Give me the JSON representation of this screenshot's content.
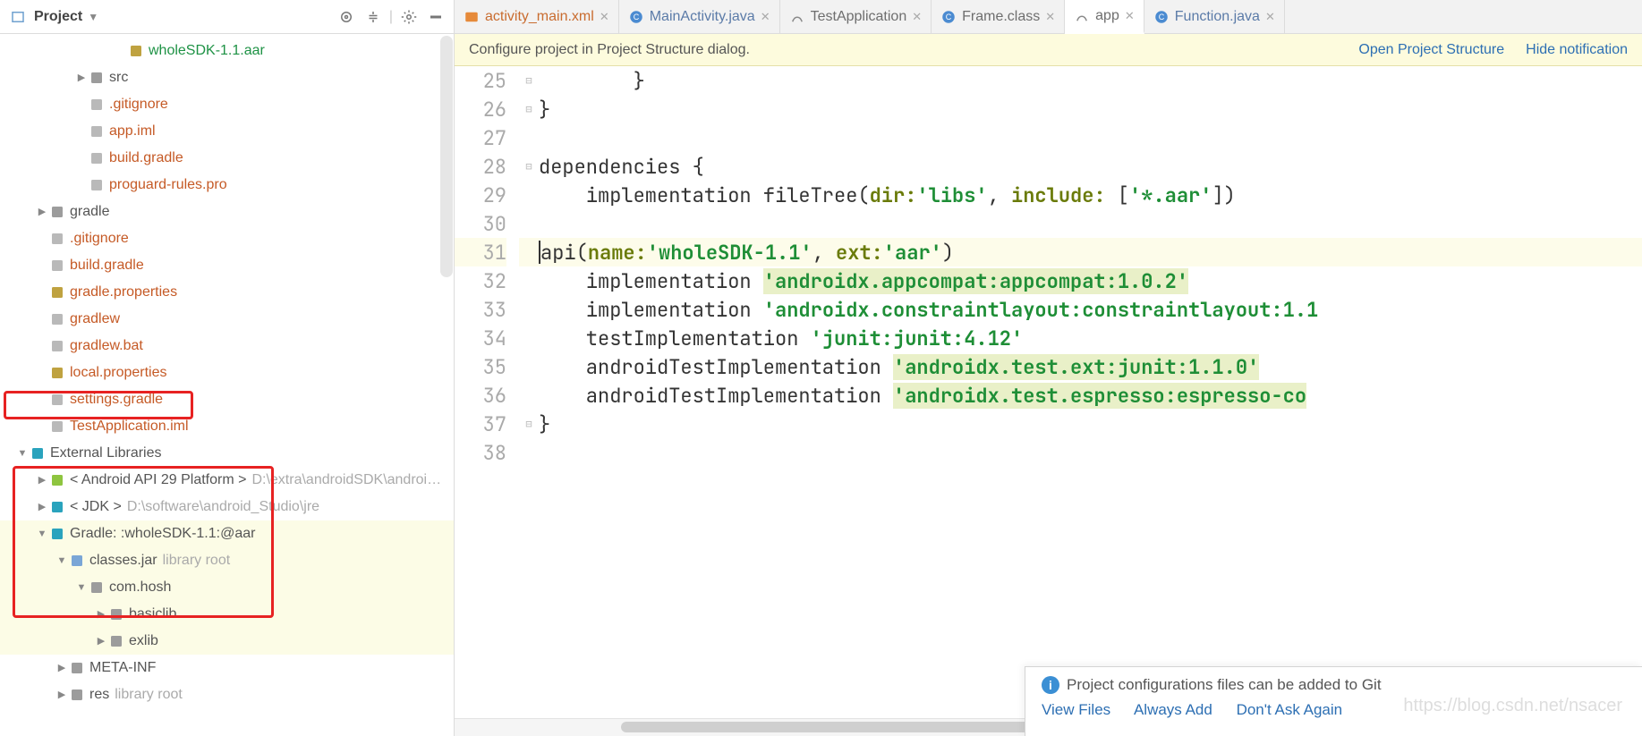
{
  "left": {
    "title": "Project",
    "toolbar_icons": [
      "target-icon",
      "collapse-icon",
      "gear-icon",
      "hide-icon"
    ],
    "tree": [
      {
        "indent": 5,
        "arrow": "",
        "iconColor": "#bfa240",
        "label": "wholeSDK-1.1.aar",
        "cls": "green-name"
      },
      {
        "indent": 3,
        "arrow": "▶",
        "iconColor": "#9c9c9c",
        "label": "src",
        "cls": "plain-name"
      },
      {
        "indent": 3,
        "arrow": "",
        "iconColor": "#b9b9b9",
        "label": ".gitignore",
        "cls": "red-name"
      },
      {
        "indent": 3,
        "arrow": "",
        "iconColor": "#b9b9b9",
        "label": "app.iml",
        "cls": "red-name"
      },
      {
        "indent": 3,
        "arrow": "",
        "iconColor": "#b9b9b9",
        "label": "build.gradle",
        "cls": "red-name"
      },
      {
        "indent": 3,
        "arrow": "",
        "iconColor": "#b9b9b9",
        "label": "proguard-rules.pro",
        "cls": "red-name"
      },
      {
        "indent": 1,
        "arrow": "▶",
        "iconColor": "#9c9c9c",
        "label": "gradle",
        "cls": "plain-name"
      },
      {
        "indent": 1,
        "arrow": "",
        "iconColor": "#b9b9b9",
        "label": ".gitignore",
        "cls": "red-name"
      },
      {
        "indent": 1,
        "arrow": "",
        "iconColor": "#b9b9b9",
        "label": "build.gradle",
        "cls": "red-name"
      },
      {
        "indent": 1,
        "arrow": "",
        "iconColor": "#bfa240",
        "label": "gradle.properties",
        "cls": "red-name"
      },
      {
        "indent": 1,
        "arrow": "",
        "iconColor": "#b9b9b9",
        "label": "gradlew",
        "cls": "red-name"
      },
      {
        "indent": 1,
        "arrow": "",
        "iconColor": "#b9b9b9",
        "label": "gradlew.bat",
        "cls": "red-name"
      },
      {
        "indent": 1,
        "arrow": "",
        "iconColor": "#bfa240",
        "label": "local.properties",
        "cls": "red-name"
      },
      {
        "indent": 1,
        "arrow": "",
        "iconColor": "#b9b9b9",
        "label": "settings.gradle",
        "cls": "red-name"
      },
      {
        "indent": 1,
        "arrow": "",
        "iconColor": "#b9b9b9",
        "label": "TestApplication.iml",
        "cls": "red-name"
      },
      {
        "indent": 0,
        "arrow": "▼",
        "iconColor": "#2aa3bd",
        "label": "External Libraries",
        "cls": "plain-name"
      },
      {
        "indent": 1,
        "arrow": "▶",
        "iconColor": "#8ec53f",
        "label": "< Android API 29 Platform >",
        "cls": "plain-name",
        "dim": "D:\\extra\\androidSDK\\androi…"
      },
      {
        "indent": 1,
        "arrow": "▶",
        "iconColor": "#2aa3bd",
        "label": "< JDK >",
        "cls": "plain-name",
        "dim": "D:\\software\\android_Studio\\jre"
      },
      {
        "indent": 1,
        "arrow": "▼",
        "iconColor": "#2aa3bd",
        "label": "Gradle: :wholeSDK-1.1:@aar",
        "cls": "plain-name",
        "hl": true
      },
      {
        "indent": 2,
        "arrow": "▼",
        "iconColor": "#7aa6d6",
        "label": "classes.jar",
        "cls": "plain-name",
        "dim": "library root",
        "hl": true
      },
      {
        "indent": 3,
        "arrow": "▼",
        "iconColor": "#9c9c9c",
        "label": "com.hosh",
        "cls": "plain-name",
        "hl": true
      },
      {
        "indent": 4,
        "arrow": "▶",
        "iconColor": "#9c9c9c",
        "label": "basiclib",
        "cls": "plain-name",
        "hl": true
      },
      {
        "indent": 4,
        "arrow": "▶",
        "iconColor": "#9c9c9c",
        "label": "exlib",
        "cls": "plain-name",
        "hl": true
      },
      {
        "indent": 2,
        "arrow": "▶",
        "iconColor": "#9c9c9c",
        "label": "META-INF",
        "cls": "plain-name"
      },
      {
        "indent": 2,
        "arrow": "▶",
        "iconColor": "#9c9c9c",
        "label": "res",
        "cls": "plain-name",
        "dim": "library root"
      }
    ]
  },
  "tabs": [
    {
      "icon": "xml",
      "label": "activity_main.xml",
      "color": "#c96c2f"
    },
    {
      "icon": "java",
      "label": "MainActivity.java",
      "color": "#5b7ba8"
    },
    {
      "icon": "gradle",
      "label": "TestApplication",
      "color": "#6e6e6e"
    },
    {
      "icon": "class",
      "label": "Frame.class",
      "color": "#6e6e6e"
    },
    {
      "icon": "gradle",
      "label": "app",
      "color": "#6e6e6e",
      "active": true
    },
    {
      "icon": "java",
      "label": "Function.java",
      "color": "#5b7ba8"
    }
  ],
  "notif": {
    "text": "Configure project in Project Structure dialog.",
    "link1": "Open Project Structure",
    "link2": "Hide notification"
  },
  "code": {
    "start": 25,
    "lines": [
      {
        "n": 25,
        "html": "        }"
      },
      {
        "n": 26,
        "html": "}"
      },
      {
        "n": 27,
        "html": ""
      },
      {
        "n": 28,
        "html": "dependencies {"
      },
      {
        "n": 29,
        "html": "    implementation fileTree(<span class='named'>dir:</span> <span class='str'>'libs'</span>, <span class='named'>include:</span> [<span class='str'>'*.aar'</span>])"
      },
      {
        "n": 30,
        "html": ""
      },
      {
        "n": 31,
        "html": "    <span class='caret'></span>api(<span class='named'>name:</span><span class='str'>'wholeSDK-1.1'</span>, <span class='named'>ext:</span><span class='str'>'aar'</span>)",
        "cur": true
      },
      {
        "n": 32,
        "html": "    implementation <span class='str-hl'>'androidx.appcompat:appcompat:1.0.2'</span>"
      },
      {
        "n": 33,
        "html": "    implementation <span class='str'>'androidx.constraintlayout:constraintlayout:1.1</span>"
      },
      {
        "n": 34,
        "html": "    testImplementation <span class='str'>'junit:junit:4.12'</span>"
      },
      {
        "n": 35,
        "html": "    androidTestImplementation <span class='str-hl'>'androidx.test.ext:junit:1.1.0'</span>"
      },
      {
        "n": 36,
        "html": "    androidTestImplementation <span class='str-hl'>'androidx.test.espresso:espresso-co</span>"
      },
      {
        "n": 37,
        "html": "}"
      },
      {
        "n": 38,
        "html": ""
      }
    ]
  },
  "toast": {
    "title": "Project configurations files can be added to Git",
    "a1": "View Files",
    "a2": "Always Add",
    "a3": "Don't Ask Again"
  },
  "watermark": "https://blog.csdn.net/nsacer"
}
